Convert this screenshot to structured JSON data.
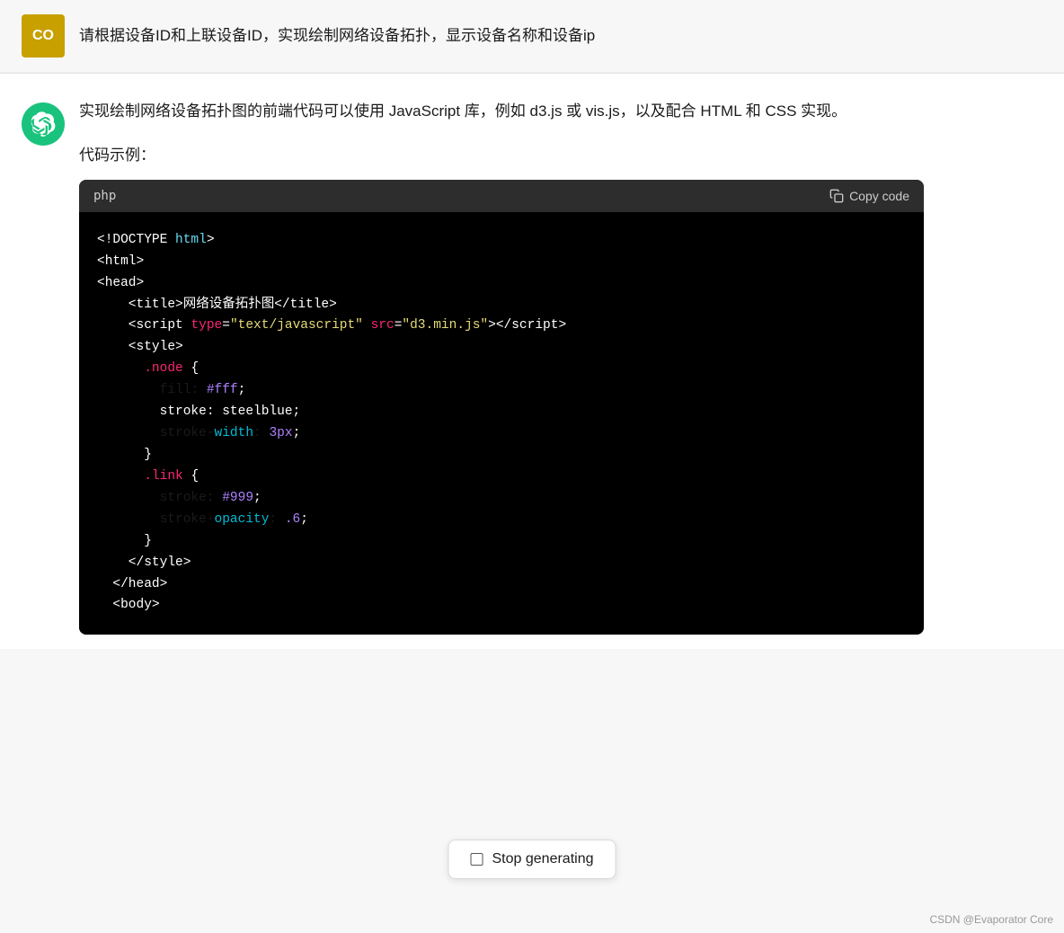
{
  "userMessage": {
    "avatar": "CO",
    "avatarBg": "#c8a000",
    "text": "请根据设备ID和上联设备ID，实现绘制网络设备拓扑，显示设备名称和设备ip"
  },
  "assistantMessage": {
    "intro": "实现绘制网络设备拓扑图的前端代码可以使用 JavaScript 库，例如 d3.js 或 vis.js，以及配合 HTML 和 CSS 实现。",
    "codeLabel": "代码示例：",
    "codeLang": "php",
    "copyBtn": "Copy code",
    "code": [
      {
        "text": "<!DOCTYPE ",
        "parts": [
          {
            "t": "<!DOCTYPE ",
            "c": "c-white"
          },
          {
            "t": "html",
            "c": "c-blue"
          },
          {
            "t": ">",
            "c": "c-white"
          }
        ]
      },
      {
        "parts": [
          {
            "t": "<html>",
            "c": "c-white"
          }
        ]
      },
      {
        "parts": [
          {
            "t": "<head>",
            "c": "c-white"
          }
        ]
      },
      {
        "indent": "    ",
        "parts": [
          {
            "t": "    <title>",
            "c": "c-white"
          },
          {
            "t": "网络设备拓扑图",
            "c": "c-white"
          },
          {
            "t": "</title>",
            "c": "c-white"
          }
        ]
      },
      {
        "parts": [
          {
            "t": "    <script ",
            "c": "c-white"
          },
          {
            "t": "type",
            "c": "c-pink"
          },
          {
            "t": "=",
            "c": "c-white"
          },
          {
            "t": "\"text/javascript\"",
            "c": "c-yellow"
          },
          {
            "t": " src",
            "c": "c-pink"
          },
          {
            "t": "=",
            "c": "c-white"
          },
          {
            "t": "\"d3.min.js\"",
            "c": "c-yellow"
          },
          {
            "t": "></",
            "c": "c-white"
          },
          {
            "t": "script",
            "c": "c-pink"
          },
          {
            "t": ">",
            "c": "c-white"
          }
        ]
      },
      {
        "parts": [
          {
            "t": "    <style>",
            "c": "c-white"
          }
        ]
      },
      {
        "parts": [
          {
            "t": "      ",
            "c": "c-white"
          },
          {
            "t": ".node",
            "c": "c-pink"
          },
          {
            "t": " {",
            "c": "c-white"
          }
        ]
      },
      {
        "parts": [
          {
            "t": "        fill: ",
            "c": "c-white"
          },
          {
            "t": "#fff",
            "c": "c-purple"
          },
          {
            "t": ";",
            "c": "c-white"
          }
        ]
      },
      {
        "parts": [
          {
            "t": "        stroke: steelblue;",
            "c": "c-white"
          }
        ]
      },
      {
        "parts": [
          {
            "t": "        stroke-",
            "c": "c-white"
          },
          {
            "t": "width",
            "c": "c-cyan"
          },
          {
            "t": ": ",
            "c": "c-white"
          },
          {
            "t": "3px",
            "c": "c-purple"
          },
          {
            "t": ";",
            "c": "c-white"
          }
        ]
      },
      {
        "parts": [
          {
            "t": "      }",
            "c": "c-white"
          }
        ]
      },
      {
        "parts": [
          {
            "t": "",
            "c": "c-white"
          }
        ]
      },
      {
        "parts": [
          {
            "t": "      ",
            "c": "c-white"
          },
          {
            "t": ".link",
            "c": "c-pink"
          },
          {
            "t": " {",
            "c": "c-white"
          }
        ]
      },
      {
        "parts": [
          {
            "t": "        stroke: ",
            "c": "c-white"
          },
          {
            "t": "#999",
            "c": "c-purple"
          },
          {
            "t": ";",
            "c": "c-white"
          }
        ]
      },
      {
        "parts": [
          {
            "t": "        stroke-",
            "c": "c-white"
          },
          {
            "t": "opacity",
            "c": "c-cyan"
          },
          {
            "t": ": ",
            "c": "c-white"
          },
          {
            "t": ".6",
            "c": "c-purple"
          },
          {
            "t": ";",
            "c": "c-white"
          }
        ]
      },
      {
        "parts": [
          {
            "t": "      }",
            "c": "c-white"
          }
        ]
      },
      {
        "parts": [
          {
            "t": "    </style>",
            "c": "c-white"
          }
        ]
      },
      {
        "parts": [
          {
            "t": "  </head>",
            "c": "c-white"
          }
        ]
      },
      {
        "parts": [
          {
            "t": "  <body>",
            "c": "c-white"
          }
        ]
      }
    ]
  },
  "stopBtn": {
    "label": "Stop generating"
  },
  "watermark": "CSDN @Evaporator Core"
}
